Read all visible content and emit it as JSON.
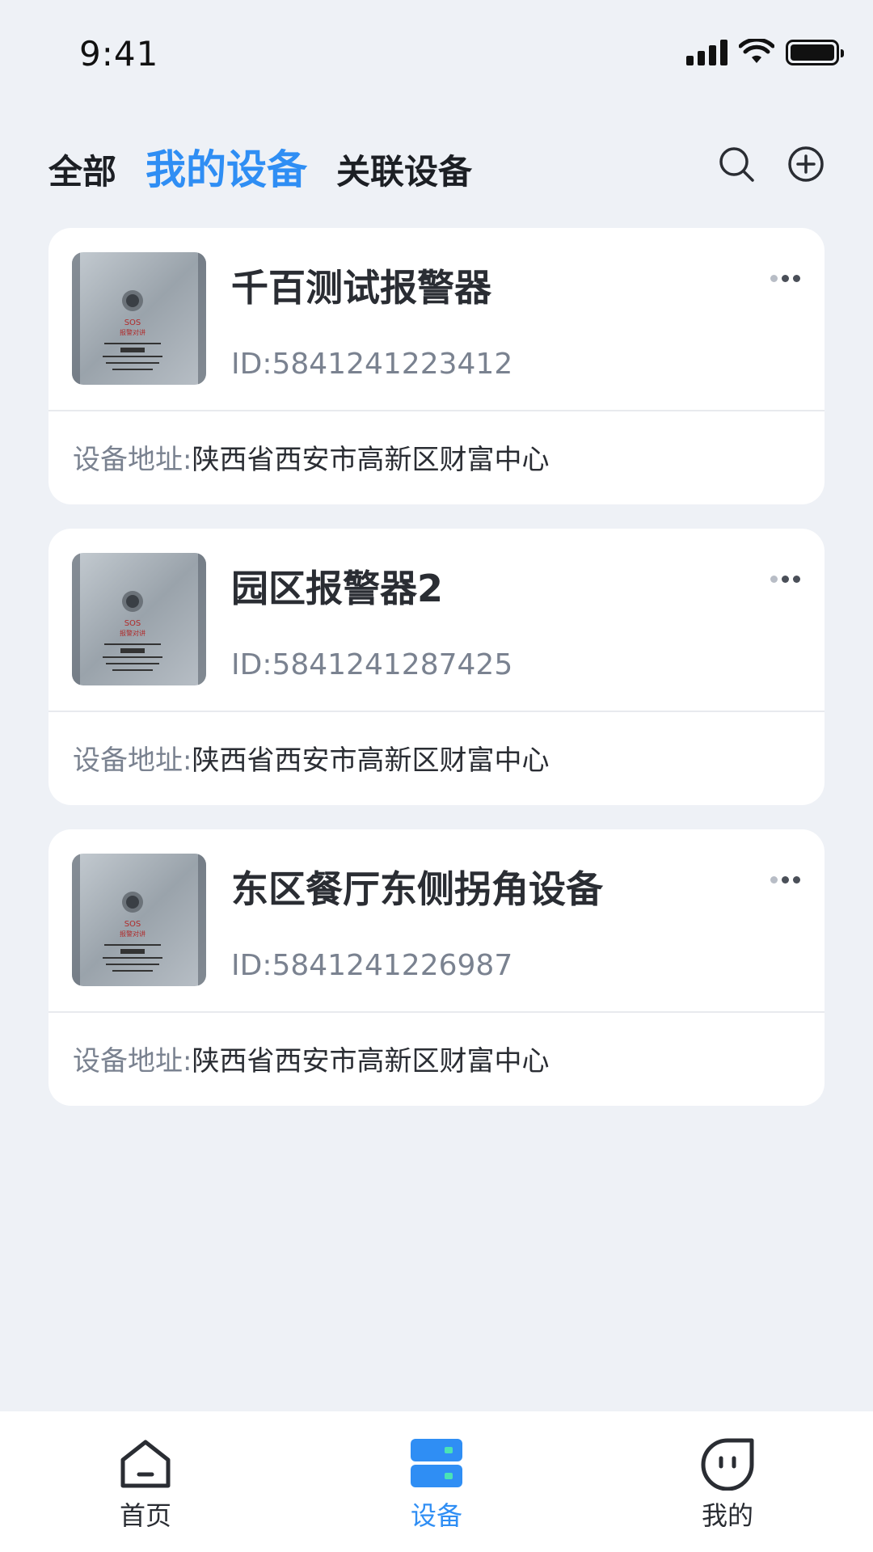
{
  "status_bar": {
    "time": "9:41"
  },
  "tabs": [
    {
      "label": "全部",
      "active": false
    },
    {
      "label": "我的设备",
      "active": true
    },
    {
      "label": "关联设备",
      "active": false
    }
  ],
  "header_icons": [
    "search-icon",
    "add-circle-icon"
  ],
  "devices": [
    {
      "name": "千百测试报警器",
      "id": "ID:5841241223412",
      "address_label": "设备地址:",
      "address": "陕西省西安市高新区财富中心"
    },
    {
      "name": "园区报警器2",
      "id": "ID:5841241287425",
      "address_label": "设备地址:",
      "address": "陕西省西安市高新区财富中心"
    },
    {
      "name": "东区餐厅东侧拐角设备",
      "id": "ID:5841241226987",
      "address_label": "设备地址:",
      "address": "陕西省西安市高新区财富中心"
    }
  ],
  "device_thumb_text": {
    "line1": "SOS",
    "line2": "报警对讲"
  },
  "bottom_nav": [
    {
      "label": "首页",
      "icon": "home-icon",
      "active": false
    },
    {
      "label": "设备",
      "icon": "device-icon",
      "active": true
    },
    {
      "label": "我的",
      "icon": "profile-icon",
      "active": false
    }
  ],
  "colors": {
    "accent": "#2f8ef4",
    "background": "#eef1f6",
    "card": "#ffffff"
  }
}
